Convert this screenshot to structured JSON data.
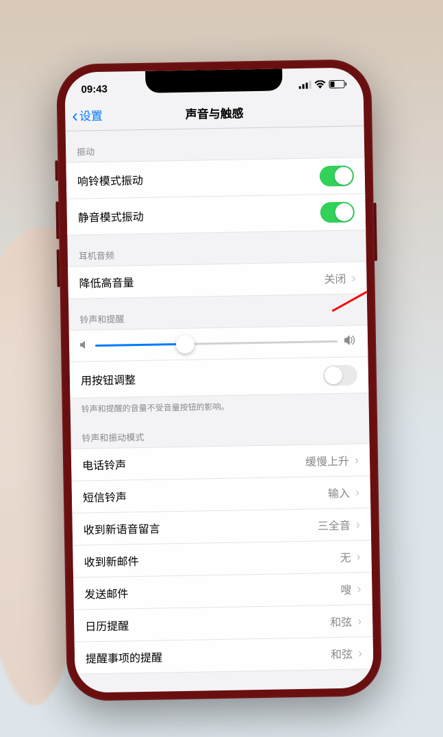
{
  "status": {
    "time": "09:43"
  },
  "nav": {
    "back": "设置",
    "title": "声音与触感"
  },
  "sections": {
    "vibration": {
      "header": "振动",
      "ring_vibrate": "响铃模式振动",
      "silent_vibrate": "静音模式振动"
    },
    "headphone": {
      "header": "耳机音频",
      "reduce_loud": "降低高音量",
      "reduce_loud_value": "关闭"
    },
    "ringer": {
      "header": "铃声和提醒",
      "change_buttons": "用按钮调整",
      "footer": "铃声和提醒的音量不受音量按钮的影响。",
      "slider_value_pct": 37
    },
    "patterns": {
      "header": "铃声和振动模式",
      "items": [
        {
          "label": "电话铃声",
          "value": "缓慢上升"
        },
        {
          "label": "短信铃声",
          "value": "输入"
        },
        {
          "label": "收到新语音留言",
          "value": "三全音"
        },
        {
          "label": "收到新邮件",
          "value": "无"
        },
        {
          "label": "发送邮件",
          "value": "嗖"
        },
        {
          "label": "日历提醒",
          "value": "和弦"
        },
        {
          "label": "提醒事项的提醒",
          "value": "和弦"
        }
      ]
    }
  },
  "colors": {
    "accent": "#007aff",
    "toggle_on": "#32d15a",
    "arrow": "#ff0000"
  }
}
